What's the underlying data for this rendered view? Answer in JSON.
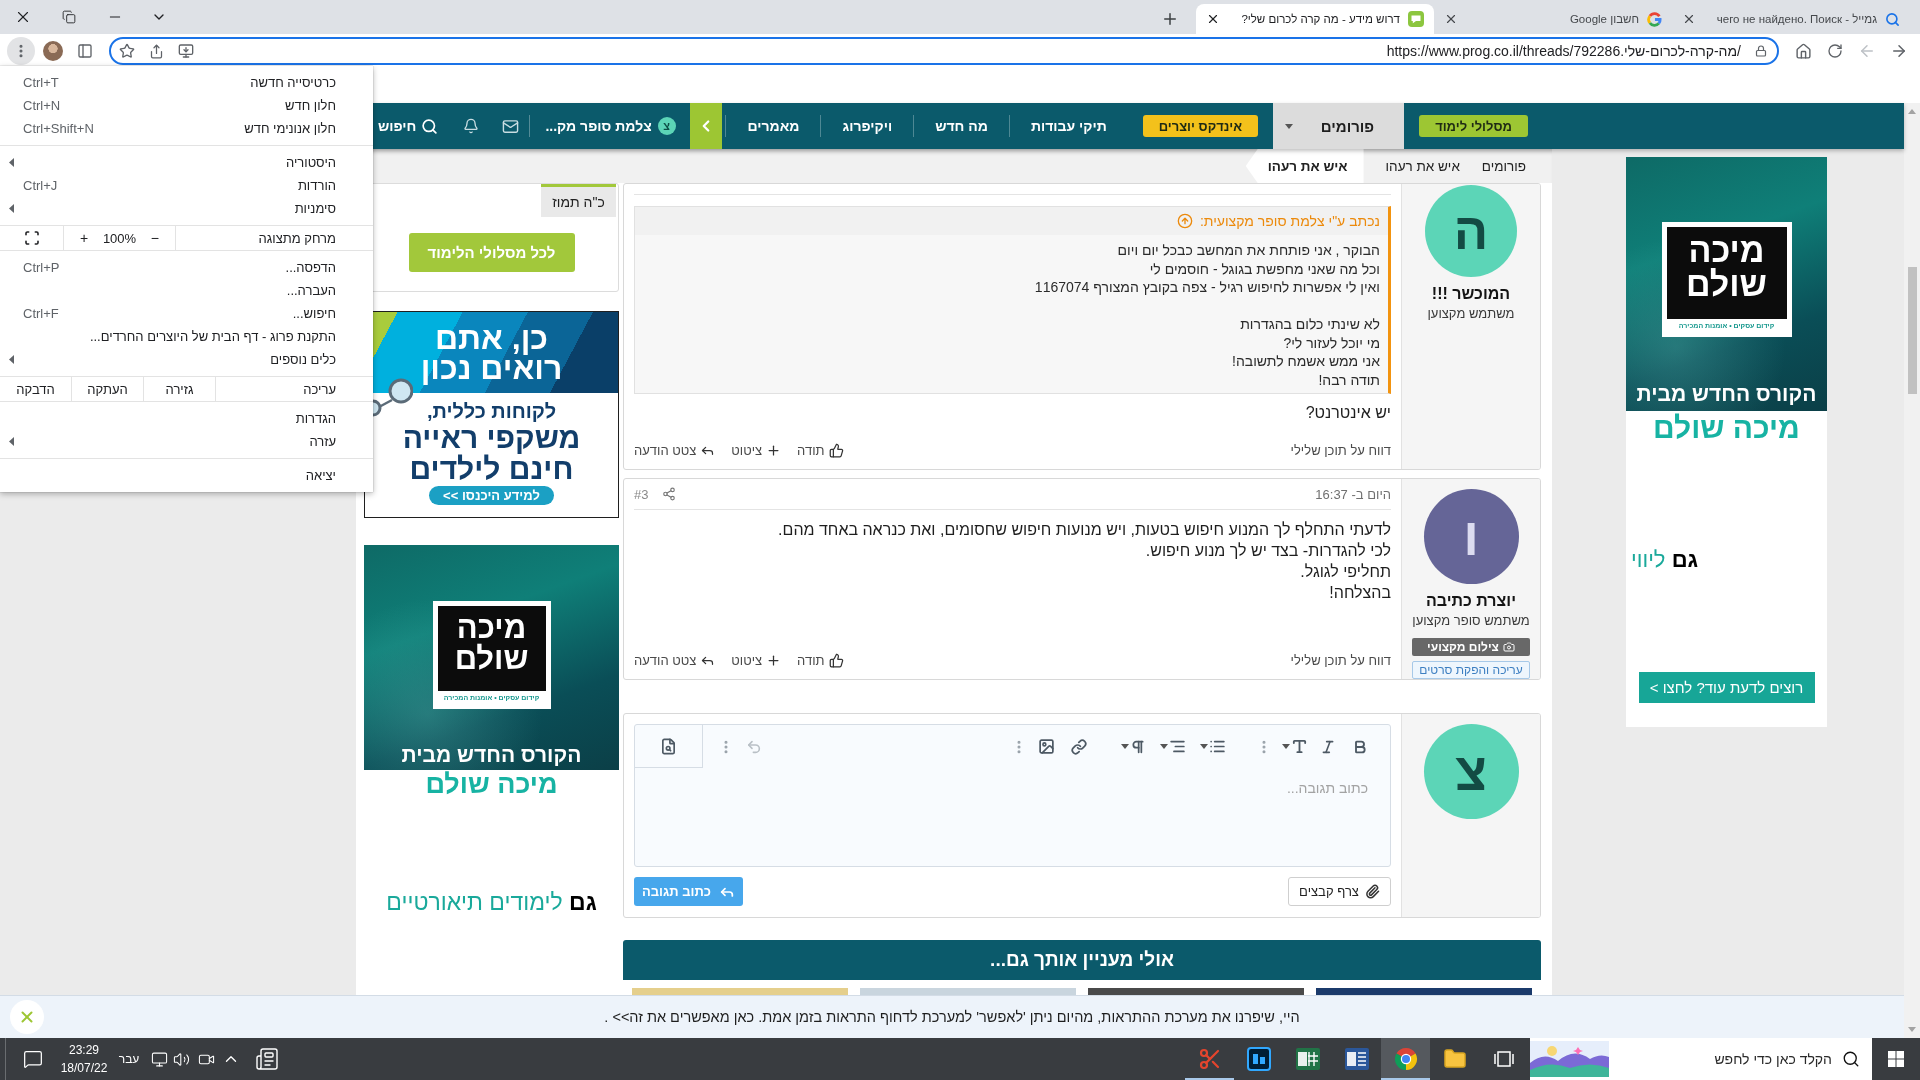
{
  "browser": {
    "tabs": [
      {
        "title": "גמייל - чего не найдено. Поиск",
        "selected": false
      },
      {
        "title": "חשבון Google",
        "selected": false
      },
      {
        "title": "דרוש מידע - מה קרה לכרום שלי?",
        "selected": true
      }
    ],
    "back": {
      "disabled": false
    },
    "forward": {
      "disabled": true
    },
    "address": {
      "url": "https://www.prog.co.il/threads/מה-קרה-לכרום-שלי.792286/",
      "focused": true
    },
    "menu_button": {
      "expanded": true
    }
  },
  "menu": {
    "groups": [
      [
        {
          "kind": "item",
          "label": "כרטיסייה חדשה",
          "shortcut": "Ctrl+T",
          "submenu": false
        },
        {
          "kind": "item",
          "label": "חלון חדש",
          "shortcut": "Ctrl+N",
          "submenu": false
        },
        {
          "kind": "item",
          "label": "חלון אנונימי חדש",
          "shortcut": "Ctrl+Shift+N",
          "submenu": false
        }
      ],
      [
        {
          "kind": "item",
          "label": "היסטוריה",
          "submenu": true
        },
        {
          "kind": "item",
          "label": "הורדות",
          "shortcut": "Ctrl+J",
          "submenu": false
        },
        {
          "kind": "item",
          "label": "סימניות",
          "submenu": true
        }
      ],
      [
        {
          "kind": "zoom",
          "label": "מרחק מתצוגה",
          "minus": "−",
          "value": "100%",
          "plus": "+"
        }
      ],
      [
        {
          "kind": "item",
          "label": "הדפסה...",
          "shortcut": "Ctrl+P",
          "submenu": false
        },
        {
          "kind": "item",
          "label": "העברה...",
          "submenu": false
        },
        {
          "kind": "item",
          "label": "חיפוש...",
          "shortcut": "Ctrl+F",
          "submenu": false
        },
        {
          "kind": "item",
          "label": "התקנת פרוג - דף הבית של היוצרים החרדים...",
          "submenu": false
        },
        {
          "kind": "item",
          "label": "כלים נוספים",
          "submenu": true
        }
      ],
      [
        {
          "kind": "edit",
          "label": "עריכה",
          "actions": [
            "גזירה",
            "העתקה",
            "הדבקה"
          ]
        }
      ],
      [
        {
          "kind": "item",
          "label": "הגדרות",
          "submenu": false
        },
        {
          "kind": "item",
          "label": "עזרה",
          "submenu": true
        }
      ],
      [
        {
          "kind": "item",
          "label": "יציאה",
          "submenu": false
        }
      ]
    ]
  },
  "nav": {
    "items": [
      {
        "kind": "pill",
        "label": "מסלולי לימוד",
        "color": "#9dc633",
        "selected": false
      },
      {
        "kind": "dropdown",
        "label": "פורומים",
        "selected": true
      },
      {
        "kind": "pill",
        "label": "אינדקס יוצרים",
        "color": "#f3c11b",
        "selected": false
      },
      {
        "kind": "link",
        "label": "תיקי עבודות",
        "selected": false
      },
      {
        "kind": "link",
        "label": "מה חדש",
        "selected": false
      },
      {
        "kind": "link",
        "label": "ויקיפרוג",
        "selected": false
      },
      {
        "kind": "link",
        "label": "מאמרים",
        "selected": false
      }
    ],
    "user": {
      "avatar": "צ",
      "name": "צלמת סופר מק..."
    },
    "search": {
      "label": "חיפוש"
    }
  },
  "breadcrumbs": [
    {
      "label": "פורומים",
      "selected": false
    },
    {
      "label": "איש את רעהו",
      "selected": false
    },
    {
      "label": "איש את רעהו",
      "selected": true
    }
  ],
  "sidebar": {
    "date": "כ\"ה תמוז",
    "button": "לכל מסלולי הלימוד",
    "ads": [
      {
        "kind": "glasses",
        "headline": [
          "כן, אתם",
          "רואים נכון"
        ],
        "intro": "לקוחות כללית,",
        "offer": [
          "משקפי ראייה",
          "חינם לילדים"
        ],
        "button": "למידע היכנסו >>"
      },
      {
        "kind": "course",
        "logo": [
          "מיכה",
          "שולם"
        ],
        "tagline": "קידום עסקים • אומנות המכירה",
        "caption": "הקורס החדש מבית",
        "brand": "מיכה שולם",
        "extra": "**גם** לימודים תיאורטיים"
      }
    ]
  },
  "posts": [
    {
      "user": {
        "avatar": "ה",
        "name": "המוכשר !!!",
        "rank": "משתמש מקצוען",
        "color": "#5cd5b7"
      },
      "quote": {
        "source": "נכתב ע\"י צלמת סופר מקצועית:",
        "paragraphs": [
          [
            "הבוקר , אני פותחת את המחשב כבכל יום ויום",
            "וכל מה שאני מחפשת בגוגל - חוסמים לי",
            "ואין לי אפשרות לחיפוש רגיל - צפה בקובץ המצורף 1167074"
          ],
          [
            "לא שינתי כלום בהגדרות",
            "מי יוכל לעזור לי?",
            "אני ממש אשמח לתשובה!",
            "תודה רבה!"
          ]
        ]
      },
      "body": [
        "יש אינטרנט?"
      ],
      "report": "דווח על תוכן שלילי",
      "actions": [
        "תודה",
        "ציטוט",
        "צטט הודעה"
      ]
    },
    {
      "user": {
        "avatar": "ו",
        "name": "יוצרת כתיבה",
        "rank": "משתמש סופר מקצוען",
        "color": "#656597",
        "badges": [
          {
            "kind": "solid",
            "label": "צילום מקצועי"
          },
          {
            "kind": "outline",
            "label": "עריכה והפקת סרטים"
          }
        ]
      },
      "time": "היום ב- 16:37",
      "number": "#3",
      "body": [
        "לדעתי התחלף לך המנוע חיפוש בטעות, ויש מנועות חיפוש שחסומים, ואת כנראה באחד מהם.",
        "לכי להגדרות- בצד יש לך מנוע חיפוש.",
        "תחליפי לגוגל.",
        "בהצלחה!"
      ],
      "report": "דווח על תוכן שלילי",
      "actions": [
        "תודה",
        "ציטוט",
        "צטט הודעה"
      ]
    }
  ],
  "reply": {
    "avatar": "צ",
    "color": "#5cd5b7",
    "placeholder": "כתוב תגובה...",
    "attach": "צרף קבצים",
    "submit": "כתוב תגובה"
  },
  "related": {
    "title": "אולי מעניין אותך גם..."
  },
  "right_ad": {
    "logo": [
      "מיכה",
      "שולם"
    ],
    "tagline": "קידום עסקים • אומנות המכירה",
    "caption": "הקורס החדש מבית",
    "brand": "מיכה שולם",
    "extra": "**גם** ליווי",
    "button": "רוצים לדעת עוד? לחצו >"
  },
  "notification": {
    "text": "היי, שיפרנו את מערכת ההתראות, מהיום ניתן 'לאפשר' למערכת לדחוף התראות בזמן אמת. כאן מאפשרים את זה>> ."
  },
  "taskbar": {
    "search": {
      "placeholder": "הקלד כאן כדי לחפש"
    },
    "apps": [
      {
        "selected": false,
        "running": false
      },
      {
        "selected": true,
        "running": true
      },
      {
        "selected": false,
        "running": false
      },
      {
        "selected": false,
        "running": false
      },
      {
        "selected": false,
        "running": false
      },
      {
        "selected": false,
        "running": true
      }
    ],
    "language": "עבר",
    "time": "23:29",
    "date": "18/07/22"
  }
}
